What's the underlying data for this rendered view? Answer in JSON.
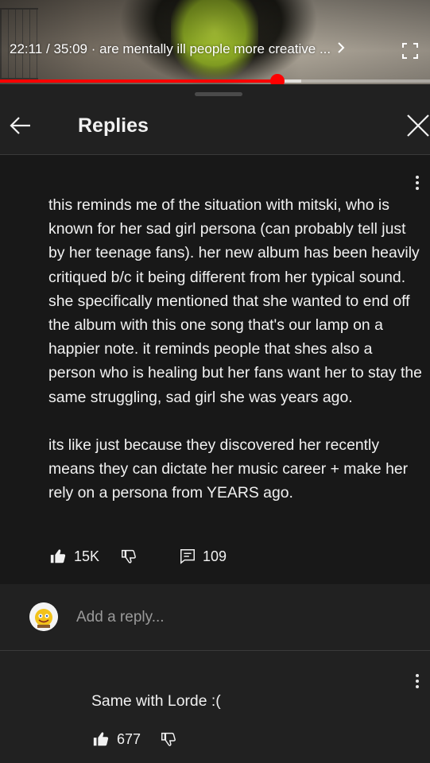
{
  "player": {
    "current_time": "22:11",
    "duration": "35:09",
    "separator": " / ",
    "dot": " · ",
    "video_title": "are mentally ill people more creative ...",
    "progress": 0.646,
    "buffered": 0.7
  },
  "header": {
    "title": "Replies"
  },
  "comment": {
    "paragraphs": [
      "this reminds me of the situation with mitski, who is known for her sad girl persona (can probably tell just by her teenage fans). her new album has been heavily critiqued b/c it being different from her typical sound. she specifically mentioned that she wanted to end off the album with this one song that's our lamp on a happier note. it reminds people that shes also a person who is healing but her fans want her to stay the same struggling, sad girl she was years ago.",
      "its like just because they discovered her recently means they can dictate her music career + make her rely on a persona from YEARS ago."
    ],
    "likes": "15K",
    "reply_count": "109"
  },
  "reply_input": {
    "placeholder": "Add a reply..."
  },
  "reply": {
    "text": "Same with Lorde :(",
    "likes": "677"
  },
  "colors": {
    "progress": "#ff0000",
    "background": "#181818",
    "sheet": "#212121"
  }
}
